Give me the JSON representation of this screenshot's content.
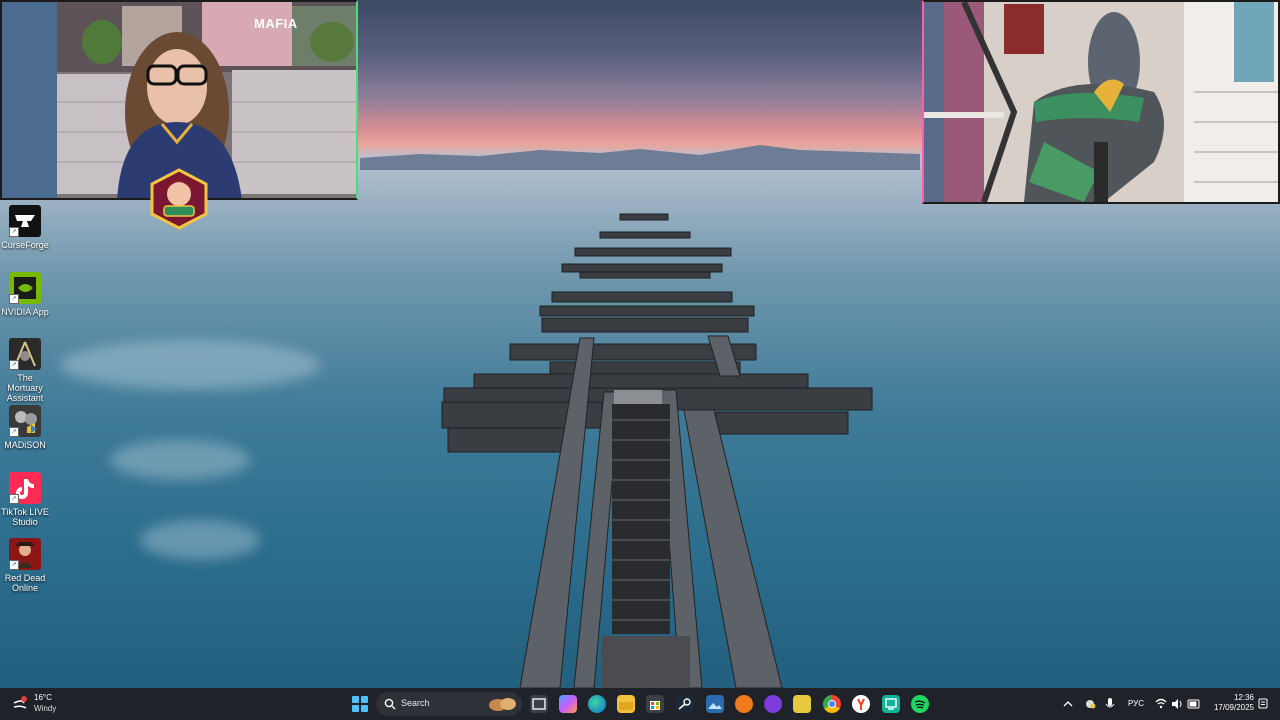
{
  "cams": {
    "left_label": "MAFIA"
  },
  "desktop_icons": [
    {
      "label": "CurseForge",
      "icon": "curseforge-icon"
    },
    {
      "label": "NVIDIA App",
      "icon": "nvidia-icon"
    },
    {
      "label": "The Mortuary Assistant",
      "icon": "mortuary-assistant-icon"
    },
    {
      "label": "MADiSON",
      "icon": "madison-icon"
    },
    {
      "label": "TikTok LIVE Studio",
      "icon": "tiktok-icon"
    },
    {
      "label": "Red Dead Online",
      "icon": "red-dead-icon"
    }
  ],
  "taskbar": {
    "weather_temp": "16°C",
    "weather_desc": "Windy",
    "search_placeholder": "Search",
    "apps": [
      "task-view-icon",
      "copilot-icon",
      "edge-icon",
      "file-explorer-icon",
      "store-icon",
      "steam-icon",
      "photos-icon",
      "app-orange-icon",
      "app-purple-icon",
      "app-yellow-icon",
      "chrome-icon",
      "yandex-icon",
      "twitch-studio-icon",
      "spotify-icon"
    ],
    "language": "РУС",
    "time": "12:36",
    "date": "17/09/2025"
  },
  "colors": {
    "accent_windows": "#4cc2ff",
    "cam_left_border": "#4ade80",
    "cam_right_border": "#ff5fa8"
  }
}
